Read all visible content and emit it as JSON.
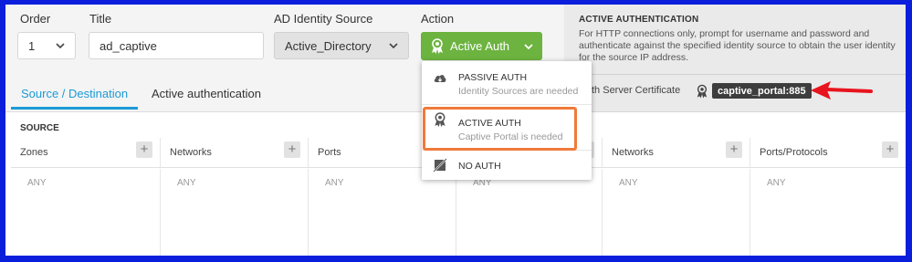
{
  "form": {
    "order_label": "Order",
    "order_value": "1",
    "title_label": "Title",
    "title_value": "ad_captive",
    "ad_source_label": "AD Identity Source",
    "ad_source_value": "Active_Directory",
    "action_label": "Action",
    "action_value": "Active Auth"
  },
  "tabs": [
    {
      "label": "Source / Destination",
      "active": true
    },
    {
      "label": "Active authentication",
      "active": false
    }
  ],
  "info_panel": {
    "title": "ACTIVE AUTHENTICATION",
    "description": "For HTTP connections only, prompt for username and password and authenticate against the specified identity source to obtain the user identity for the source IP address.",
    "cert_label": "th Server Certificate",
    "cert_value": "captive_portal:885"
  },
  "source": {
    "title": "SOURCE",
    "columns": [
      {
        "header": "Zones",
        "value": "ANY"
      },
      {
        "header": "Networks",
        "value": "ANY"
      },
      {
        "header": "Ports",
        "value": "ANY"
      },
      {
        "header": "",
        "value": "ANY"
      },
      {
        "header": "Networks",
        "value": "ANY"
      },
      {
        "header": "Ports/Protocols",
        "value": "ANY"
      }
    ]
  },
  "dropdown": {
    "items": [
      {
        "label": "PASSIVE AUTH",
        "sub": "Identity Sources are needed",
        "icon": "cloud-icon"
      },
      {
        "label": "ACTIVE AUTH",
        "sub": "Captive Portal is needed",
        "icon": "badge-icon"
      },
      {
        "label": "NO AUTH",
        "sub": "",
        "icon": "no-auth-icon"
      }
    ]
  },
  "colors": {
    "accent_blue": "#1d9ad6",
    "action_green": "#6cb33f",
    "highlight_orange": "#f07a3a",
    "annotation_red": "#e8141e",
    "frame_blue": "#0a1edb"
  }
}
